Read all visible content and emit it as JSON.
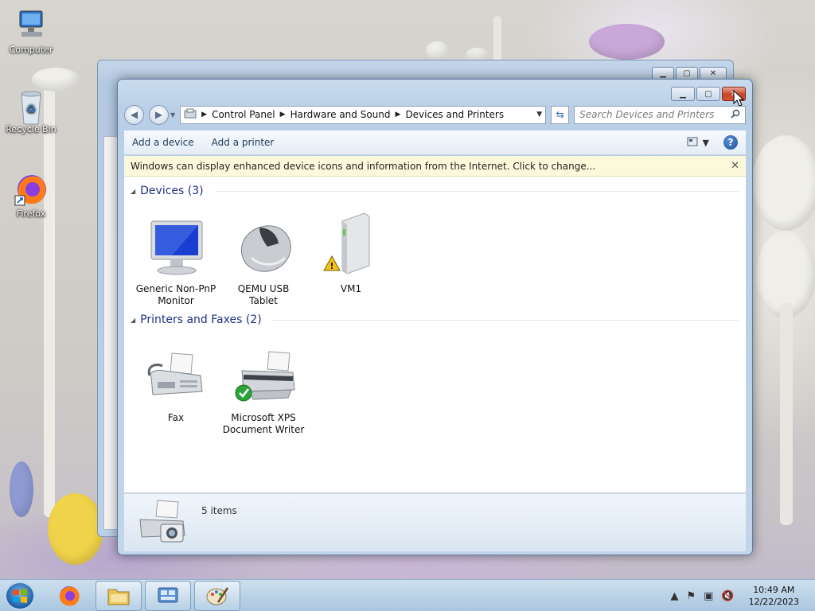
{
  "desktop": {
    "icons": [
      {
        "label": "Computer"
      },
      {
        "label": "Recycle Bin"
      },
      {
        "label": "Firefox"
      }
    ]
  },
  "window": {
    "address": {
      "crumbs": [
        "Control Panel",
        "Hardware and Sound",
        "Devices and Printers"
      ]
    },
    "search": {
      "placeholder": "Search Devices and Printers"
    },
    "toolbar": {
      "add_device": "Add a device",
      "add_printer": "Add a printer"
    },
    "infobar": {
      "text": "Windows can display enhanced device icons and information from the Internet. Click to change..."
    },
    "groups": {
      "devices": {
        "title": "Devices (3)",
        "items": [
          {
            "label": "Generic Non-PnP Monitor",
            "icon": "monitor-icon"
          },
          {
            "label": "QEMU USB Tablet",
            "icon": "mouse-icon"
          },
          {
            "label": "VM1",
            "icon": "computer-tower-icon",
            "warning": true
          }
        ]
      },
      "printers": {
        "title": "Printers and Faxes (2)",
        "items": [
          {
            "label": "Fax",
            "icon": "fax-icon"
          },
          {
            "label": "Microsoft XPS Document Writer",
            "icon": "printer-icon",
            "default": true
          }
        ]
      }
    },
    "details": {
      "count": "5 items"
    }
  },
  "taskbar": {
    "clock": {
      "time": "10:49 AM",
      "date": "12/22/2023"
    }
  },
  "colors": {
    "group_header": "#1e3287",
    "infobar_bg": "#fcf8dc",
    "close_button": "#c6442b"
  }
}
